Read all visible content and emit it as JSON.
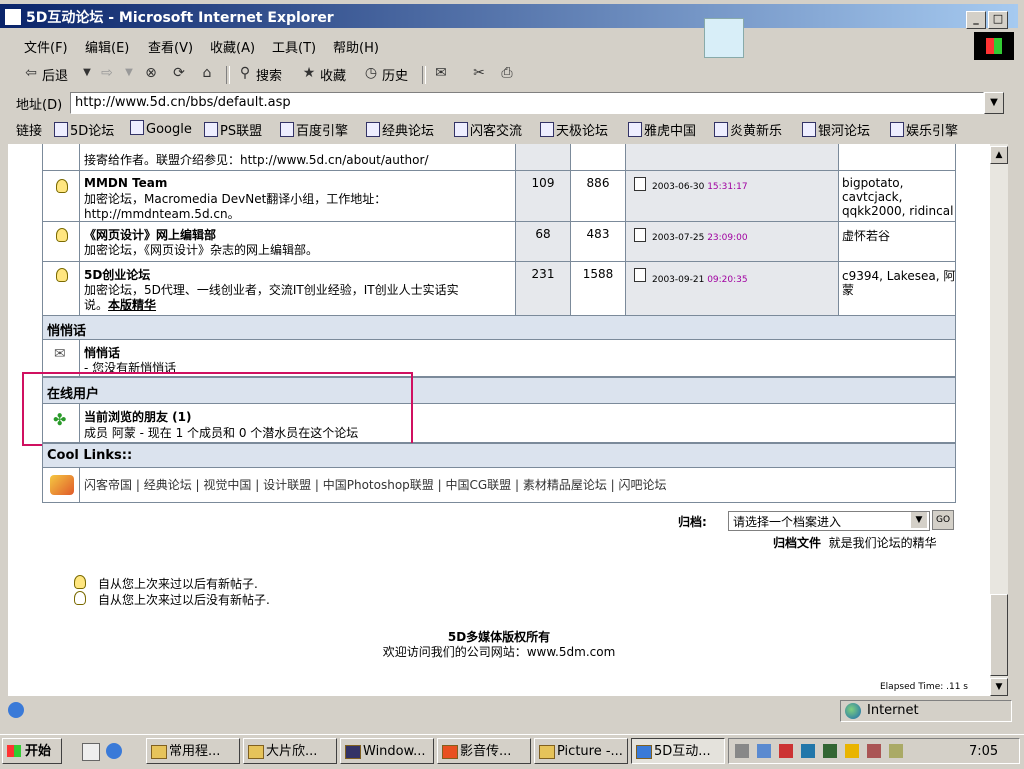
{
  "window": {
    "title": "5D互动论坛 - Microsoft Internet Explorer"
  },
  "menu": [
    "文件(F)",
    "编辑(E)",
    "查看(V)",
    "收藏(A)",
    "工具(T)",
    "帮助(H)"
  ],
  "toolbar": {
    "back": "后退",
    "search": "搜索",
    "favorites": "收藏",
    "history": "历史"
  },
  "address": {
    "label": "地址(D)",
    "url": "http://www.5d.cn/bbs/default.asp"
  },
  "links": {
    "label": "链接",
    "items": [
      "5D论坛",
      "Google",
      "PS联盟",
      "百度引擎",
      "经典论坛",
      "闪客交流",
      "天极论坛",
      "雅虎中国",
      "炎黄新乐",
      "银河论坛",
      "娱乐引擎"
    ]
  },
  "forums": [
    {
      "desc_partial": "接寄给作者。联盟介绍参见：http://www.5d.cn/about/author/"
    },
    {
      "title": "MMDN Team",
      "desc": [
        "加密论坛，Macromedia DevNet翻译小组，工作地址：",
        "http://mmdnteam.5d.cn。"
      ],
      "topics": "109",
      "posts": "886",
      "date": "2003-06-30",
      "time": "15:31:17",
      "mods": [
        "bigpotato,",
        "cavtcjack,",
        "qqkk2000, ridincal"
      ]
    },
    {
      "title": "《网页设计》网上编辑部",
      "desc": [
        "加密论坛，《网页设计》杂志的网上编辑部。"
      ],
      "topics": "68",
      "posts": "483",
      "date": "2003-07-25",
      "time": "23:09:00",
      "mods": [
        "虚怀若谷"
      ]
    },
    {
      "title": "5D创业论坛",
      "desc": [
        "加密论坛，5D代理、一线创业者，交流IT创业经验，IT创业人士实话实",
        "说。"
      ],
      "link": "本版精华",
      "topics": "231",
      "posts": "1588",
      "date": "2003-09-21",
      "time": "09:20:35",
      "mods": [
        "c9394, Lakesea, 阿",
        "蒙"
      ]
    }
  ],
  "pm": {
    "header": "悄悄话",
    "title": "悄悄话",
    "text": "- 您没有新悄悄话"
  },
  "online": {
    "header": "在线用户",
    "title": "当前浏览的朋友 (1)",
    "text": "成员  阿蒙  - 现在  1 个成员和  0 个潜水员在这个论坛"
  },
  "cool": {
    "header": "Cool Links::",
    "items": [
      "闪客帝国",
      "经典论坛",
      "视觉中国",
      "设计联盟",
      "中国Photoshop联盟",
      "中国CG联盟",
      "素材精品屋论坛",
      "闪吧论坛"
    ]
  },
  "archive": {
    "label": "归档:",
    "placeholder": "请选择一个档案进入",
    "go": "GO",
    "note_bold": "归档文件",
    "note": "就是我们论坛的精华"
  },
  "legend": [
    "自从您上次来过以后有新帖子.",
    "自从您上次来过以后没有新帖子."
  ],
  "footer": {
    "copyright": "5D多媒体版权所有",
    "visit": "欢迎访问我们的公司网站：www.5dm.com",
    "elapsed": "Elapsed Time: .11 s"
  },
  "status": {
    "zone": "Internet"
  },
  "taskbar": {
    "start": "开始",
    "tasks": [
      "常用程...",
      "大片欣...",
      "Window...",
      "影音传...",
      "Picture -...",
      "5D互动..."
    ],
    "clock": "7:05"
  }
}
